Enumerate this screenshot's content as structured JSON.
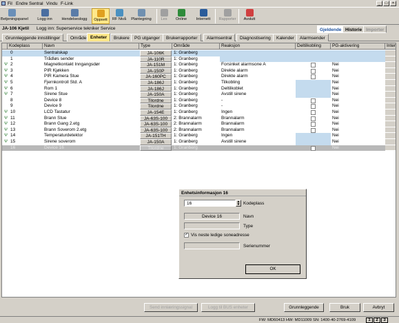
{
  "menubar": {
    "items": [
      "Fil",
      "Endre",
      "Sentral",
      "Vindu",
      "F-Link"
    ]
  },
  "toolbar": {
    "buttons": [
      {
        "label": "Betjeningspanel",
        "color": "#6a8fb8"
      },
      {
        "label": "Logg inn",
        "color": "#4a6ea0"
      },
      {
        "label": "Hendelseslogg",
        "color": "#5a7ca8"
      },
      {
        "label": "Oppsett",
        "color": "#e0a020"
      },
      {
        "label": "RF Nivå",
        "color": "#4a90c0"
      },
      {
        "label": "Plantegning",
        "color": "#7090b0"
      },
      {
        "label": "Les",
        "color": "#a0a0a0"
      },
      {
        "label": "Online",
        "color": "#2e8b3a"
      },
      {
        "label": "Internett",
        "color": "#2a5c9a"
      },
      {
        "label": "Rapporter",
        "color": "#a0a0a0"
      },
      {
        "label": "Avslutt",
        "color": "#d04040"
      }
    ]
  },
  "infobar": {
    "device": "JA-106 Kjetil",
    "login": "Logg inn: Superservice  tekniker Service"
  },
  "righttabs": [
    "Gjeldende",
    "Historie",
    "Importer"
  ],
  "tabs": [
    "Grunnleggende innstillinger",
    "Område",
    "Enheter",
    "Brukere",
    "PG utganger",
    "Brukerrapporter",
    "Alarmsentral",
    "Diagnostisering",
    "Kalender",
    "Alarmsender"
  ],
  "grid": {
    "headers": [
      "Kodeplass",
      "Navn",
      "Type",
      "Område",
      "Reaksjon",
      "Deltilkobling",
      "PG-aktivering",
      "Inter"
    ],
    "rows": [
      {
        "n": "0",
        "name": "Sentralskap",
        "type": "JA-106K",
        "area": "1: Granberg",
        "reaction": "",
        "cb": false,
        "pg": "",
        "sel": true,
        "icon": false
      },
      {
        "n": "1",
        "name": "Trådløs sender",
        "type": "JA-110R",
        "area": "1: Granberg",
        "reaction": "",
        "cb": false,
        "pg": "",
        "sel": false,
        "icon": false
      },
      {
        "n": "2",
        "name": "Magnetkontakt Inngangsdør",
        "type": "JA-151M",
        "area": "1: Granberg",
        "reaction": "Forsinket alarmsone A",
        "cb": true,
        "pg": "Nei",
        "sel": false,
        "icon": true
      },
      {
        "n": "3",
        "name": "PIR Kjøkken",
        "type": "JA-150P",
        "area": "1: Granberg",
        "reaction": "Direkte alarm",
        "cb": true,
        "pg": "Nei",
        "sel": false,
        "icon": true
      },
      {
        "n": "4",
        "name": "PIR Kamera Stue",
        "type": "JA-160PC",
        "area": "1: Granberg",
        "reaction": "Direkte alarm",
        "cb": true,
        "pg": "Nei",
        "sel": false,
        "icon": true
      },
      {
        "n": "5",
        "name": "Fjernkontroll Std. A",
        "type": "JA-186J",
        "area": "1: Granberg",
        "reaction": "Tilkobling",
        "cb": false,
        "pg": "Nei",
        "sel": false,
        "icon": true
      },
      {
        "n": "6",
        "name": "Rom 1",
        "type": "JA-186J",
        "area": "1: Granberg",
        "reaction": "Deltilkoblet",
        "cb": false,
        "pg": "Nei",
        "sel": false,
        "icon": true
      },
      {
        "n": "7",
        "name": "Sirene Stue",
        "type": "JA-150A",
        "area": "1: Granberg",
        "reaction": "Avstill sirene",
        "cb": false,
        "pg": "Nei",
        "sel": false,
        "icon": true
      },
      {
        "n": "8",
        "name": "Device 8",
        "type": "Tilordne",
        "area": "1: Granberg",
        "reaction": "-",
        "cb": true,
        "pg": "Nei",
        "sel": false,
        "icon": false
      },
      {
        "n": "9",
        "name": "Device 9",
        "type": "Tilordne",
        "area": "1: Granberg",
        "reaction": "-",
        "cb": true,
        "pg": "Nei",
        "sel": false,
        "icon": false
      },
      {
        "n": "10",
        "name": "LCD Tastatur",
        "type": "JA-154E",
        "area": "1: Granberg",
        "reaction": "Ingen",
        "cb": true,
        "pg": "Nei",
        "sel": false,
        "icon": true
      },
      {
        "n": "11",
        "name": "Brann Stue",
        "type": "JA-63S-100",
        "area": "2: Brannalarm",
        "reaction": "Brannalarm",
        "cb": true,
        "pg": "Nei",
        "sel": false,
        "icon": true
      },
      {
        "n": "12",
        "name": "Brann Gang 2.etg",
        "type": "JA-63S-100",
        "area": "2: Brannalarm",
        "reaction": "Brannalarm",
        "cb": true,
        "pg": "Nei",
        "sel": false,
        "icon": true
      },
      {
        "n": "13",
        "name": "Brann Soverom 2.etg",
        "type": "JA-63S-100",
        "area": "2: Brannalarm",
        "reaction": "Brannalarm",
        "cb": true,
        "pg": "Nei",
        "sel": false,
        "icon": true
      },
      {
        "n": "14",
        "name": "Temperaturdetektor",
        "type": "JA-151TH",
        "area": "1: Granberg",
        "reaction": "Ingen",
        "cb": false,
        "pg": "Nei",
        "sel": false,
        "icon": true
      },
      {
        "n": "15",
        "name": "Sirene soverom",
        "type": "JA-150A",
        "area": "1: Granberg",
        "reaction": "Avstill sirene",
        "cb": false,
        "pg": "Nei",
        "sel": false,
        "icon": true
      },
      {
        "n": "16",
        "name": "Device 16",
        "type": "Tilordne",
        "area": "1: Granberg",
        "reaction": "",
        "cb": true,
        "pg": "Nei",
        "sel": false,
        "icon": false,
        "dim": true
      }
    ]
  },
  "dialog": {
    "title": "Enhetsinformasjon 16",
    "kodeplass_value": "16",
    "kodeplass_label": "Kodeplass",
    "navn_value": "Device 16",
    "navn_label": "Navn",
    "type_value": "",
    "type_label": "Type",
    "checkbox_label": "Vis neste ledige soneadresse",
    "serie_value": "",
    "serie_label": "Serienummer",
    "ok_label": "OK"
  },
  "bottom": {
    "btn_send": "Send innlæringssignal",
    "btn_logg": "Logg til BUS enheter",
    "btn_grunn": "Grunnleggende",
    "btn_bruk": "Bruk",
    "btn_avbryt": "Avbryt"
  },
  "status": {
    "text": "FW: MD60413 HW: MD11009 SN: 1400-40-2769-4109",
    "pages": [
      "1",
      "2",
      "3"
    ]
  }
}
